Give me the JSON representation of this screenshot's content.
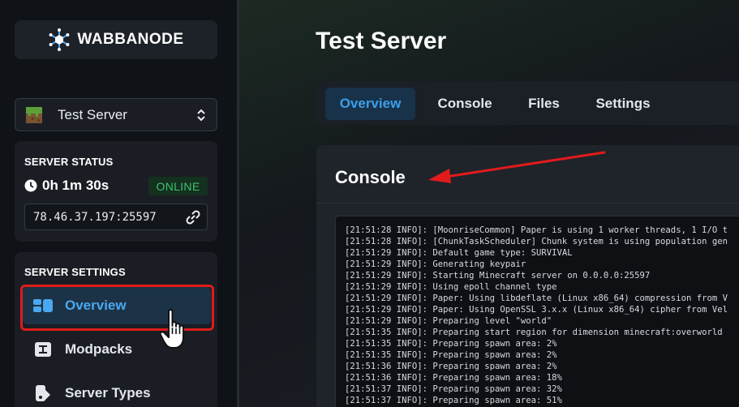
{
  "brand": {
    "name": "WABBANODE"
  },
  "server_select": {
    "name": "Test Server"
  },
  "server_status": {
    "title": "SERVER STATUS",
    "uptime": "0h 1m 30s",
    "state": "ONLINE",
    "address": "78.46.37.197:25597"
  },
  "server_settings": {
    "title": "SERVER SETTINGS",
    "items": [
      {
        "label": "Overview",
        "icon": "overview-icon",
        "active": true
      },
      {
        "label": "Modpacks",
        "icon": "modpack-icon",
        "active": false
      },
      {
        "label": "Server Types",
        "icon": "server-types-icon",
        "active": false
      }
    ]
  },
  "main": {
    "title": "Test Server",
    "tabs": [
      {
        "label": "Overview",
        "active": true
      },
      {
        "label": "Console",
        "active": false
      },
      {
        "label": "Files",
        "active": false
      },
      {
        "label": "Settings",
        "active": false
      }
    ],
    "console": {
      "title": "Console",
      "lines": [
        "[21:51:28 INFO]: [MoonriseCommon] Paper is using 1 worker threads, 1 I/O t",
        "[21:51:28 INFO]: [ChunkTaskScheduler] Chunk system is using population gen",
        "[21:51:29 INFO]: Default game type: SURVIVAL",
        "[21:51:29 INFO]: Generating keypair",
        "[21:51:29 INFO]: Starting Minecraft server on 0.0.0.0:25597",
        "[21:51:29 INFO]: Using epoll channel type",
        "[21:51:29 INFO]: Paper: Using libdeflate (Linux x86_64) compression from V",
        "[21:51:29 INFO]: Paper: Using OpenSSL 3.x.x (Linux x86_64) cipher from Vel",
        "[21:51:29 INFO]: Preparing level \"world\"",
        "[21:51:35 INFO]: Preparing start region for dimension minecraft:overworld",
        "[21:51:35 INFO]: Preparing spawn area: 2%",
        "[21:51:35 INFO]: Preparing spawn area: 2%",
        "[21:51:36 INFO]: Preparing spawn area: 2%",
        "[21:51:36 INFO]: Preparing spawn area: 18%",
        "[21:51:37 INFO]: Preparing spawn area: 32%",
        "[21:51:37 INFO]: Preparing spawn area: 51%"
      ]
    }
  },
  "colors": {
    "accent": "#3d9fe8",
    "online": "#3ec26e",
    "annotation": "#e01b1b"
  }
}
